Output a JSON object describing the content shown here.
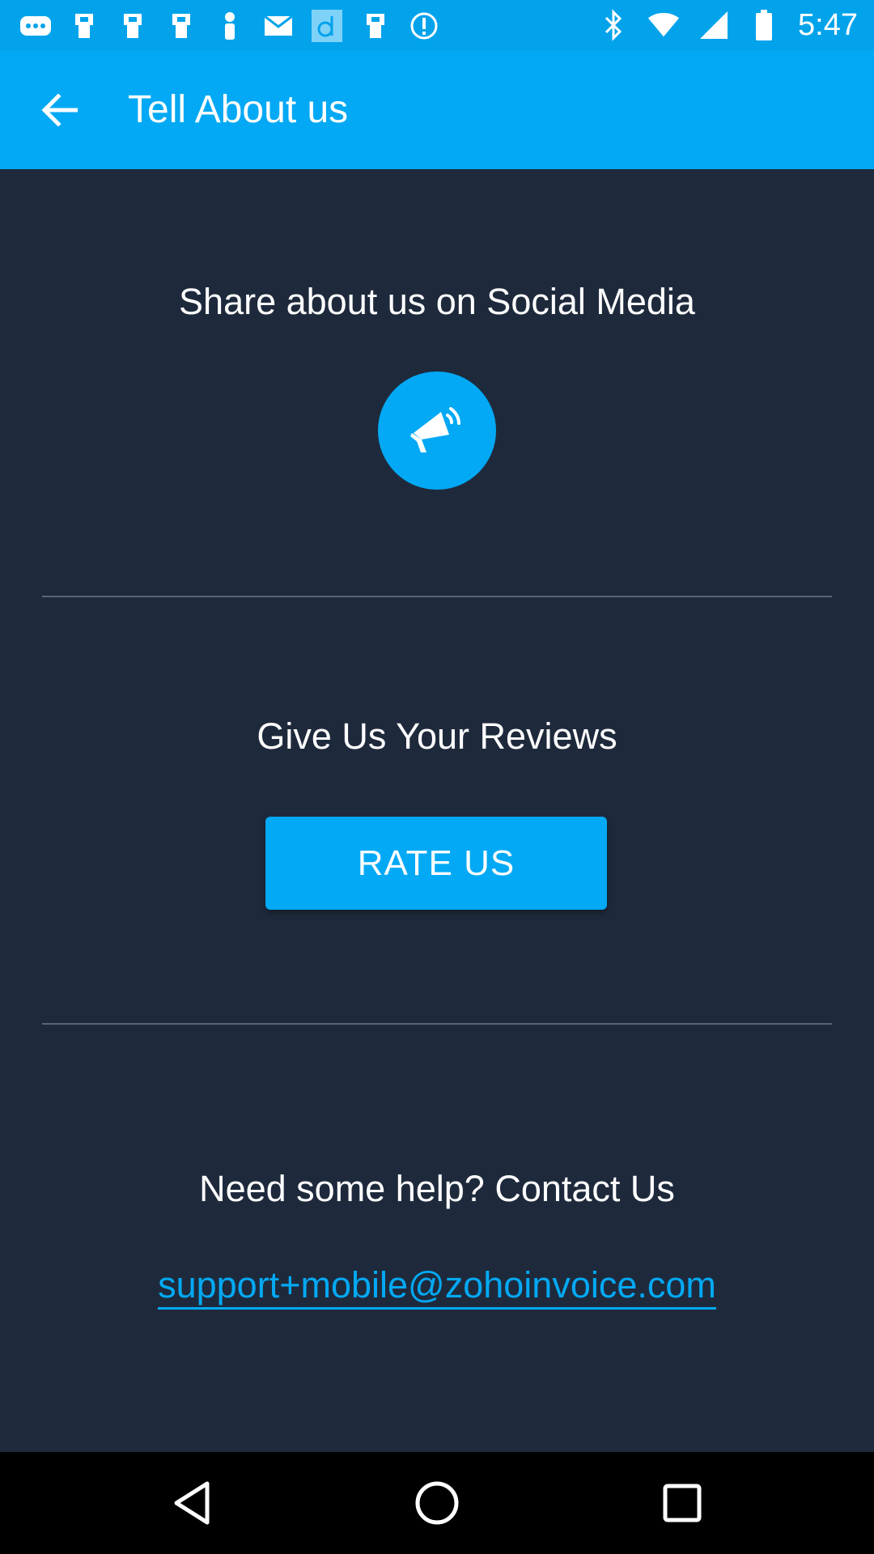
{
  "status_bar": {
    "time": "5:47",
    "left_icons": [
      "more-icon",
      "notification-icon",
      "notification-icon",
      "notification-icon",
      "mail-icon",
      "app-d-icon",
      "notification-icon",
      "alert-circle-icon"
    ],
    "right_icons": [
      "bluetooth-icon",
      "wifi-icon",
      "signal-icon",
      "battery-icon"
    ]
  },
  "app_bar": {
    "title": "Tell About us",
    "back_icon": "arrow-back-icon"
  },
  "share_section": {
    "heading": "Share about us on Social Media",
    "icon": "megaphone-icon"
  },
  "review_section": {
    "heading": "Give Us Your Reviews",
    "button_label": "RATE US"
  },
  "contact_section": {
    "heading": "Need some help? Contact Us",
    "email": "support+mobile@zohoinvoice.com"
  },
  "nav_bar": {
    "icons": [
      "back-triangle-icon",
      "home-circle-icon",
      "recents-square-icon"
    ]
  },
  "colors": {
    "primary": "#03a9f4",
    "status_bar": "#03a3eb",
    "background": "#1e2a3c",
    "divider": "#5a6472"
  }
}
